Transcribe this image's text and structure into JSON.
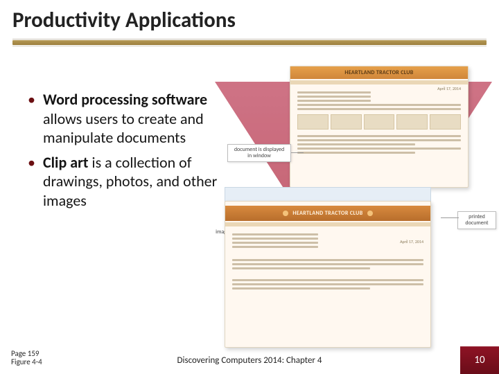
{
  "title": "Productivity Applications",
  "bullets": [
    {
      "bold": "Word processing software",
      "rest": " allows users to create and manipulate documents"
    },
    {
      "bold": "Clip art",
      "rest": " is a collection of drawings, photos, and other images"
    }
  ],
  "figure": {
    "doc_header": "HEARTLAND TRACTOR CLUB",
    "doc_date_top": "April 17, 2014",
    "banner_text": "HEARTLAND TRACTOR CLUB",
    "doc_date_bottom": "April 17, 2014",
    "callout_window": "document is displayed in window",
    "callout_printed": "printed document",
    "callout_image": "image"
  },
  "footer": {
    "page_ref_line1": "Page 159",
    "page_ref_line2": "Figure 4-4",
    "center": "Discovering Computers 2014: Chapter 4",
    "slide_number": "10"
  }
}
